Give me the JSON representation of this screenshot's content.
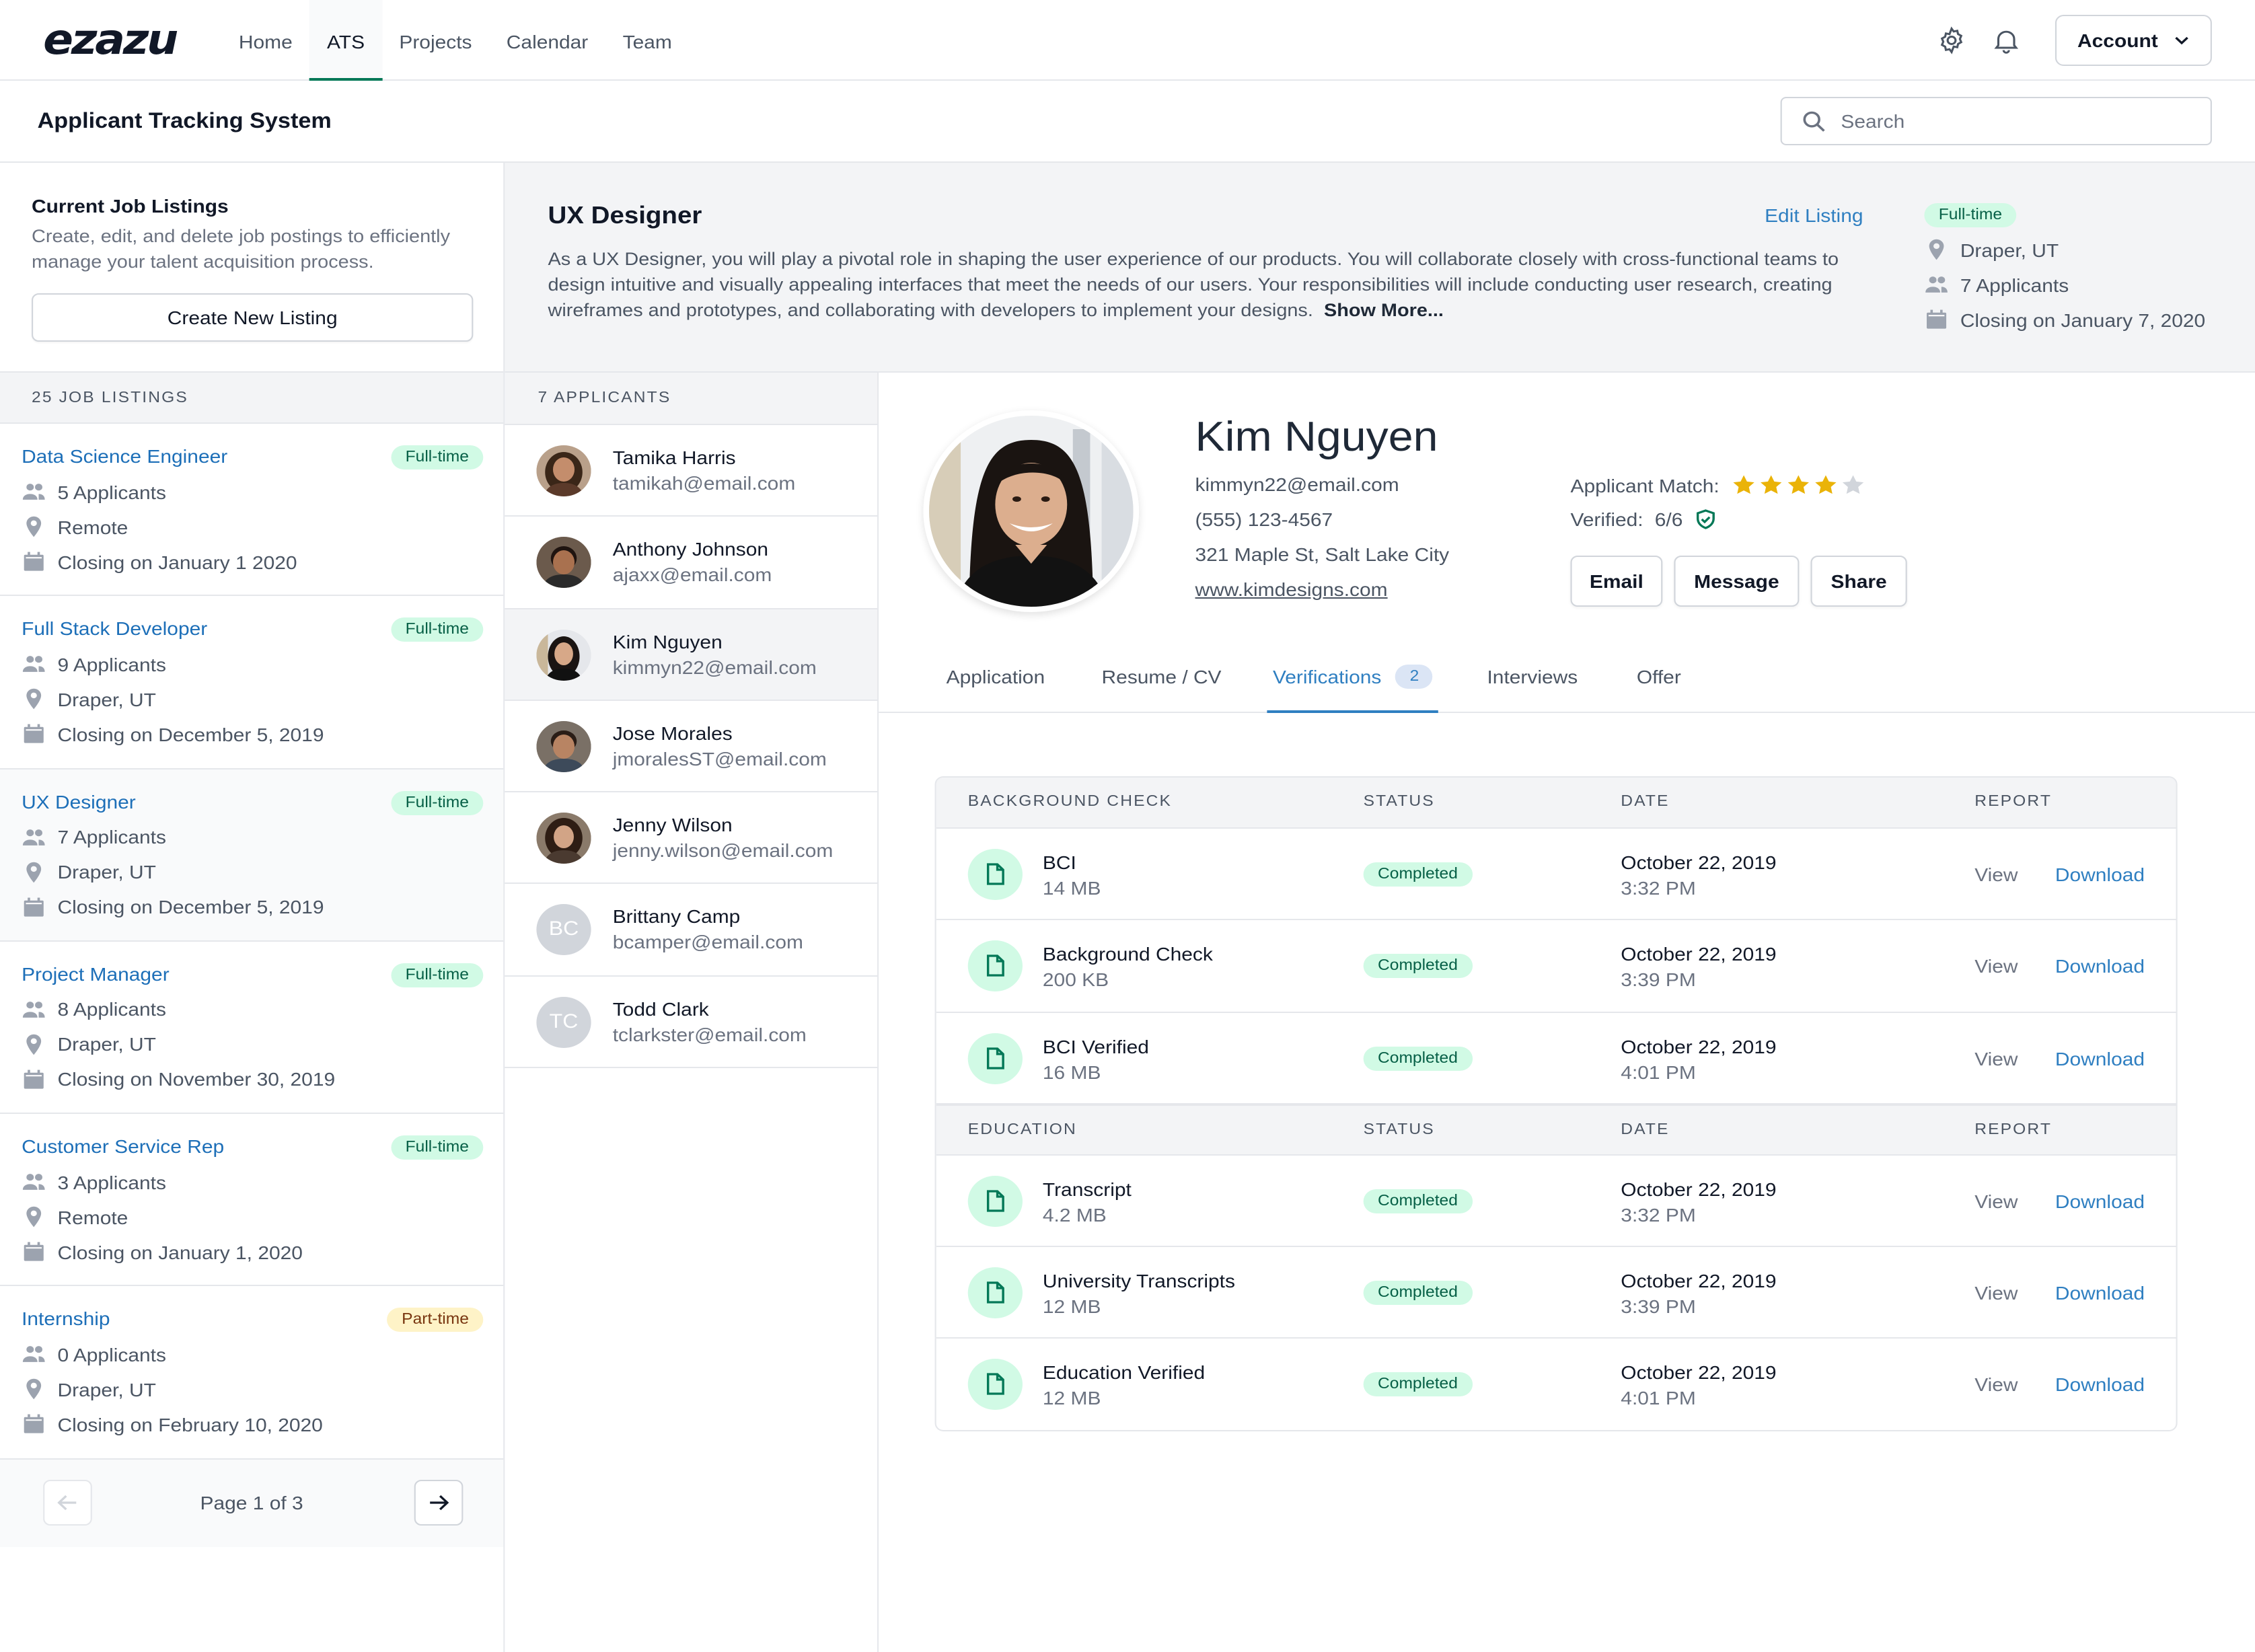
{
  "brand": {
    "logo": "ezazu",
    "accent": "#047857",
    "link": "#2f7fc1"
  },
  "nav": {
    "items": [
      "Home",
      "ATS",
      "Projects",
      "Calendar",
      "Team"
    ],
    "active": "ATS"
  },
  "header": {
    "account_label": "Account",
    "app_title": "Applicant Tracking System",
    "search_placeholder": "Search"
  },
  "sidebar": {
    "title": "Current Job Listings",
    "description": "Create, edit, and delete job postings to efficiently manage your talent acquisition process.",
    "create_label": "Create New Listing",
    "count_label": "25 JOB LISTINGS",
    "jobs": [
      {
        "title": "Data Science Engineer",
        "type": "Full-time",
        "applicants": "5 Applicants",
        "location": "Remote",
        "closing": "Closing on January 1 2020"
      },
      {
        "title": "Full Stack Developer",
        "type": "Full-time",
        "applicants": "9 Applicants",
        "location": "Draper, UT",
        "closing": "Closing on December 5, 2019"
      },
      {
        "title": "UX Designer",
        "type": "Full-time",
        "applicants": "7 Applicants",
        "location": "Draper, UT",
        "closing": "Closing on December 5, 2019"
      },
      {
        "title": "Project Manager",
        "type": "Full-time",
        "applicants": "8 Applicants",
        "location": "Draper, UT",
        "closing": "Closing on November 30, 2019"
      },
      {
        "title": "Customer Service Rep",
        "type": "Full-time",
        "applicants": "3 Applicants",
        "location": "Remote",
        "closing": "Closing on January 1, 2020"
      },
      {
        "title": "Internship",
        "type": "Part-time",
        "applicants": "0 Applicants",
        "location": "Draper, UT",
        "closing": "Closing on February 10, 2020"
      }
    ],
    "pager": "Page 1 of 3"
  },
  "job": {
    "title": "UX Designer",
    "edit_label": "Edit Listing",
    "description": "As a UX Designer, you will play a pivotal role in shaping the user experience of our products. You will collaborate closely with cross-functional teams to design intuitive and visually appealing interfaces that meet the needs of our users. Your responsibilities will include conducting user research, creating wireframes and prototypes, and collaborating with developers to implement your designs.",
    "show_more": "Show More...",
    "type": "Full-time",
    "location": "Draper, UT",
    "applicants": "7 Applicants",
    "closing": "Closing on January 7, 2020"
  },
  "applicants": {
    "count_label": "7 APPLICANTS",
    "list": [
      {
        "name": "Tamika Harris",
        "email": "tamikah@email.com"
      },
      {
        "name": "Anthony Johnson",
        "email": "ajaxx@email.com"
      },
      {
        "name": "Kim Nguyen",
        "email": "kimmyn22@email.com"
      },
      {
        "name": "Jose Morales",
        "email": "jmoralesST@email.com"
      },
      {
        "name": "Jenny Wilson",
        "email": "jenny.wilson@email.com"
      },
      {
        "name": "Brittany Camp",
        "email": "bcamper@email.com",
        "initials": "BC"
      },
      {
        "name": "Todd Clark",
        "email": "tclarkster@email.com",
        "initials": "TC"
      }
    ]
  },
  "profile": {
    "name": "Kim Nguyen",
    "email": "kimmyn22@email.com",
    "phone": "(555) 123-4567",
    "address": "321 Maple St, Salt Lake City",
    "website": "www.kimdesigns.com",
    "match_label": "Applicant Match:",
    "match_stars": 4,
    "match_max": 5,
    "verified_label": "Verified:",
    "verified_value": "6/6",
    "buttons": [
      "Email",
      "Message",
      "Share"
    ],
    "tabs": [
      "Application",
      "Resume / CV",
      "Verifications",
      "Interviews",
      "Offer"
    ],
    "active_tab": "Verifications",
    "verifications_count": "2"
  },
  "verifications": {
    "columns": {
      "status": "STATUS",
      "date": "DATE",
      "report": "REPORT"
    },
    "view_label": "View",
    "download_label": "Download",
    "sections": [
      {
        "title": "BACKGROUND CHECK",
        "rows": [
          {
            "name": "BCI",
            "size": "14 MB",
            "status": "Completed",
            "date": "October 22, 2019",
            "time": "3:32 PM"
          },
          {
            "name": "Background Check",
            "size": "200 KB",
            "status": "Completed",
            "date": "October 22, 2019",
            "time": "3:39 PM"
          },
          {
            "name": "BCI Verified",
            "size": "16 MB",
            "status": "Completed",
            "date": "October 22, 2019",
            "time": "4:01 PM"
          }
        ]
      },
      {
        "title": "EDUCATION",
        "rows": [
          {
            "name": "Transcript",
            "size": "4.2 MB",
            "status": "Completed",
            "date": "October 22, 2019",
            "time": "3:32 PM"
          },
          {
            "name": "University Transcripts",
            "size": "12 MB",
            "status": "Completed",
            "date": "October 22, 2019",
            "time": "3:39 PM"
          },
          {
            "name": "Education Verified",
            "size": "12 MB",
            "status": "Completed",
            "date": "October 22, 2019",
            "time": "4:01 PM"
          }
        ]
      }
    ]
  }
}
